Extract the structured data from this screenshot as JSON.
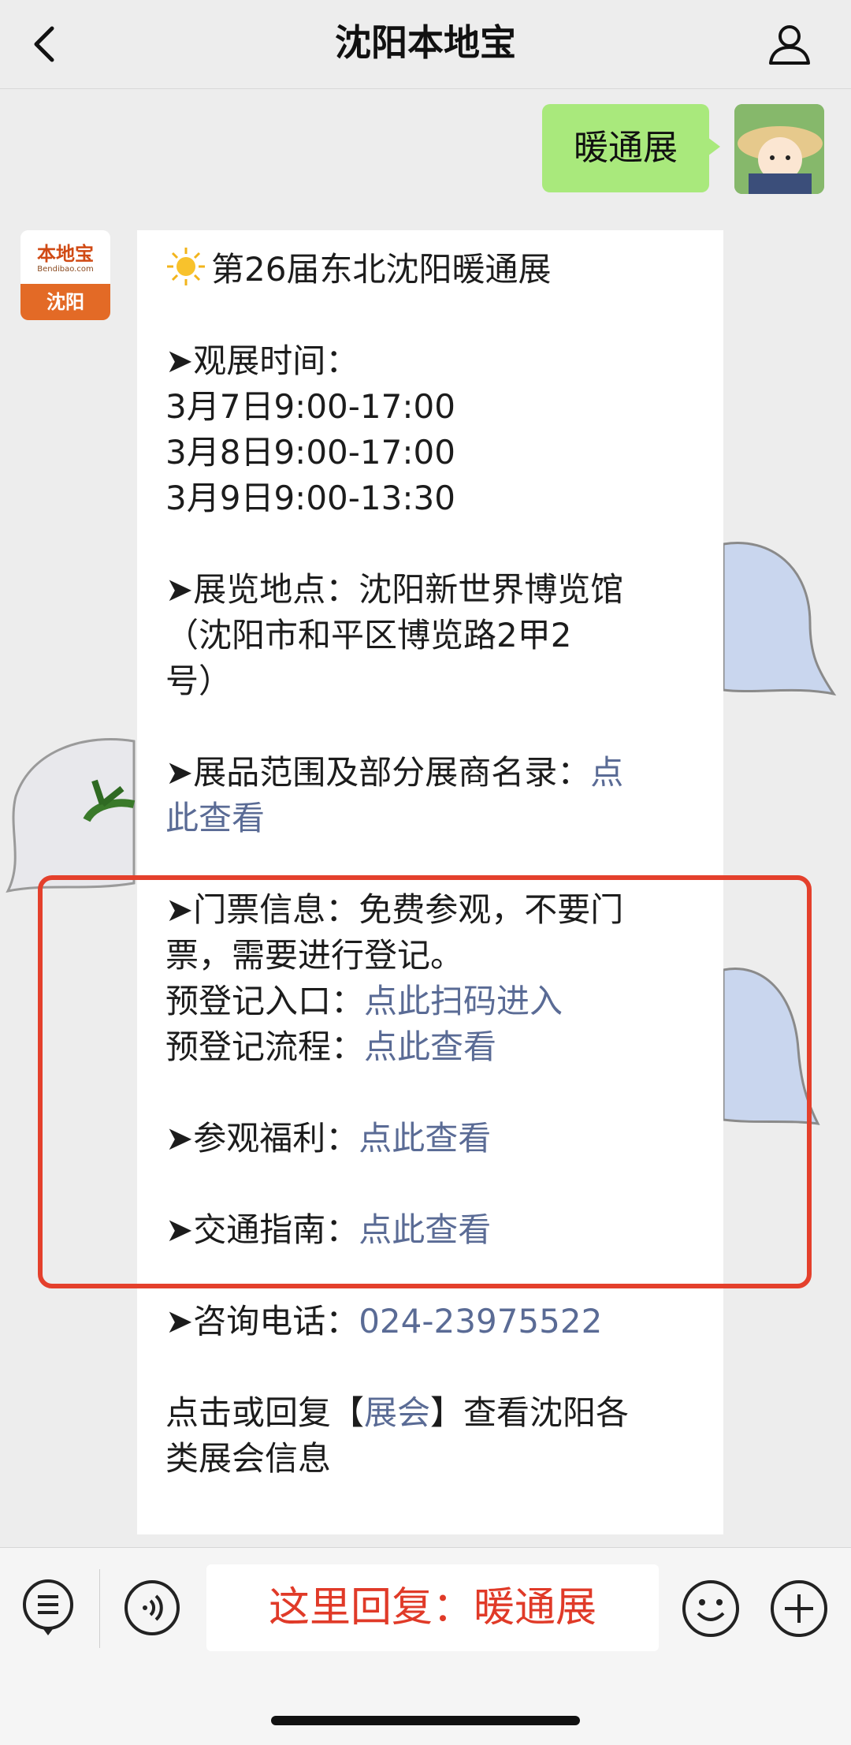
{
  "header": {
    "title": "沈阳本地宝"
  },
  "sent_message": {
    "text": "暖通展"
  },
  "bot_avatar": {
    "logo_text": "本地宝",
    "logo_sub": "Bendibao.com",
    "city": "沈阳"
  },
  "message": {
    "title": "第26届东北沈阳暖通展",
    "time_label": "➤观展时间：",
    "times": [
      "3月7日9:00-17:00",
      "3月8日9:00-17:00",
      "3月9日9:00-13:30"
    ],
    "venue_line1": "➤展览地点：沈阳新世界博览馆",
    "venue_line2": "（沈阳市和平区博览路2甲2",
    "venue_line3": "号）",
    "exhibits_label": "➤展品范围及部分展商名录：",
    "exhibits_link_a": "点",
    "exhibits_link_b": "此查看",
    "ticket_line1": "➤门票信息：免费参观，不要门",
    "ticket_line2": "票，需要进行登记。",
    "prereg_entry_label": "预登记入口：",
    "prereg_entry_link": "点此扫码进入",
    "prereg_flow_label": "预登记流程：",
    "prereg_flow_link": "点此查看",
    "benefits_label": "➤参观福利：",
    "benefits_link": "点此查看",
    "traffic_label": "➤交通指南：",
    "traffic_link": "点此查看",
    "phone_label": "➤咨询电话：",
    "phone_value": "024-23975522",
    "footer_a": "点击或回复【",
    "footer_link": "展会",
    "footer_b": "】查看沈阳各",
    "footer_line2": "类展会信息"
  },
  "bottom_bar": {
    "reply_text": "这里回复：暖通展"
  },
  "colors": {
    "link": "#5a6b95",
    "highlight": "#e4402c",
    "sent_bubble": "#a9e97c"
  }
}
